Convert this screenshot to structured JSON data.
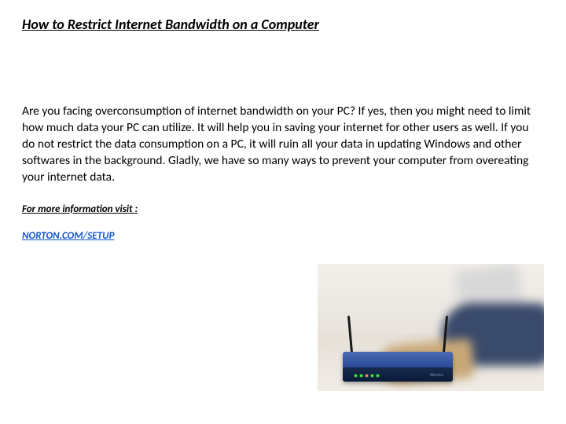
{
  "title": "How to Restrict Internet Bandwidth on a Computer",
  "body": "Are you facing overconsumption of internet bandwidth on your PC? If yes, then you might need to limit how much data your PC can utilize. It will help you in saving your internet for other users as well. If you do not restrict the data consumption on a PC, it will ruin all your data in updating Windows and other softwares in the background. Gladly, we have so many ways to prevent your computer from overeating your internet data.",
  "info_label": "For more information visit :",
  "link_text": "NORTON.COM/SETUP",
  "image_alt": "router-and-person-with-laptop"
}
